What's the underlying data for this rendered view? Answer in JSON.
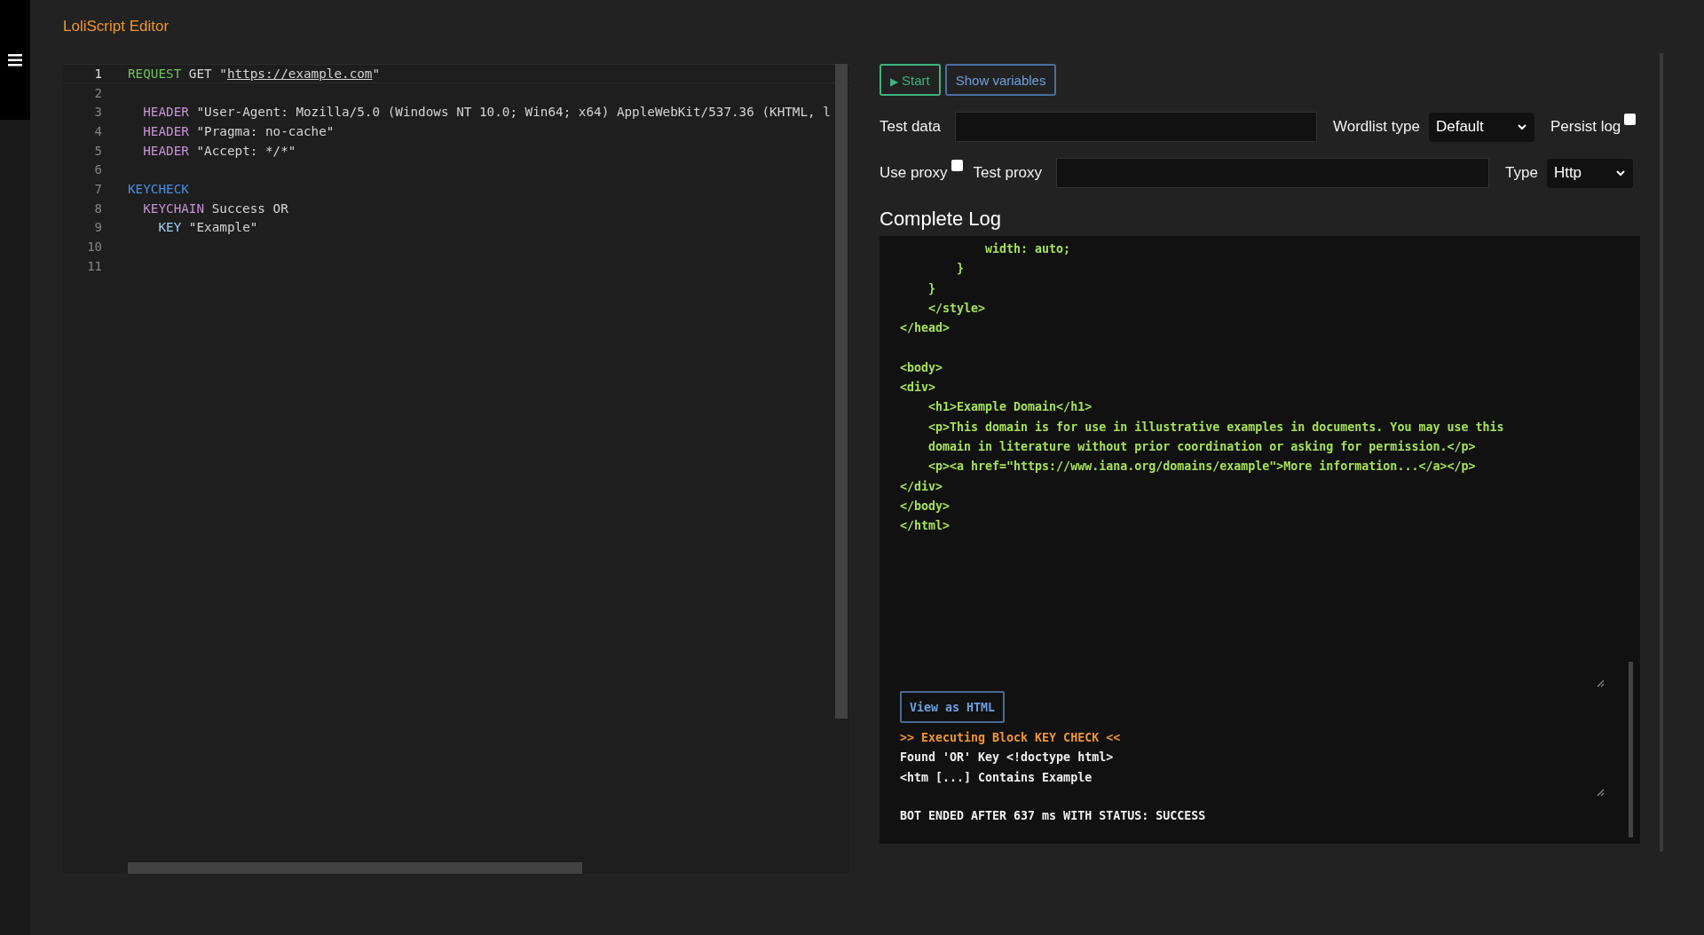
{
  "page_title": "LoliScript Editor",
  "editor": {
    "lines": [
      {
        "number": "1",
        "active": true,
        "tokens": [
          {
            "kind": "block",
            "text": "REQUEST"
          },
          {
            "kind": "text",
            "text": " GET \""
          },
          {
            "kind": "url",
            "text": "https://example.com"
          },
          {
            "kind": "text",
            "text": "\""
          }
        ]
      },
      {
        "number": "2",
        "active": false
      },
      {
        "number": "3",
        "active": false,
        "tokens": [
          {
            "kind": "command",
            "text": "  HEADER"
          },
          {
            "kind": "text",
            "text": " \"User-Agent: Mozilla/5.0 (Windows NT 10.0; Win64; x64) AppleWebKit/537.36 (KHTML, l"
          }
        ]
      },
      {
        "number": "4",
        "active": false,
        "tokens": [
          {
            "kind": "command",
            "text": "  HEADER"
          },
          {
            "kind": "text",
            "text": " \"Pragma: no-cache\""
          }
        ]
      },
      {
        "number": "5",
        "active": false,
        "tokens": [
          {
            "kind": "command",
            "text": "  HEADER"
          },
          {
            "kind": "text",
            "text": " \"Accept: */*\""
          }
        ]
      },
      {
        "number": "6",
        "active": false
      },
      {
        "number": "7",
        "active": false,
        "tokens": [
          {
            "kind": "keycheck",
            "text": "KEYCHECK"
          }
        ]
      },
      {
        "number": "8",
        "active": false,
        "tokens": [
          {
            "kind": "command",
            "text": "  KEYCHAIN"
          },
          {
            "kind": "text",
            "text": " Success OR"
          }
        ]
      },
      {
        "number": "9",
        "active": false,
        "tokens": [
          {
            "kind": "key",
            "text": "    KEY"
          },
          {
            "kind": "text",
            "text": " \"Example\""
          }
        ]
      },
      {
        "number": "10",
        "active": false
      },
      {
        "number": "11",
        "active": false
      }
    ]
  },
  "buttons": [
    {
      "kind": "start",
      "icon": "▶",
      "label": "Start"
    },
    {
      "kind": "secondary",
      "label": "Show variables"
    }
  ],
  "test_data": {
    "label": "Test data"
  },
  "wordlist_type": {
    "label": "Wordlist type",
    "value": "Default"
  },
  "persist_log": {
    "label": "Persist log",
    "checked": false
  },
  "use_proxy": {
    "label": "Use proxy",
    "checked": false
  },
  "test_proxy": {
    "label": "Test proxy"
  },
  "proxy_type": {
    "label": "Type",
    "value": "Http"
  },
  "log": {
    "title": "Complete Log",
    "response": "            width: auto;\n        }\n    }\n    </style>\n</head>\n\n<body>\n<div>\n    <h1>Example Domain</h1>\n    <p>This domain is for use in illustrative examples in documents. You may use this\n    domain in literature without prior coordination or asking for permission.</p>\n    <p><a href=\"https://www.iana.org/domains/example\">More information...</a></p>\n</div>\n</body>\n</html>",
    "view_button": "View as HTML",
    "entries": [
      {
        "kind": "header",
        "text": ">> Executing Block KEY CHECK <<"
      },
      {
        "kind": "info",
        "text": "Found 'OR' Key <!doctype html>\n<htm [...] Contains Example"
      },
      {
        "kind": "result",
        "text": "BOT ENDED AFTER 637 ms WITH STATUS: SUCCESS"
      }
    ]
  }
}
